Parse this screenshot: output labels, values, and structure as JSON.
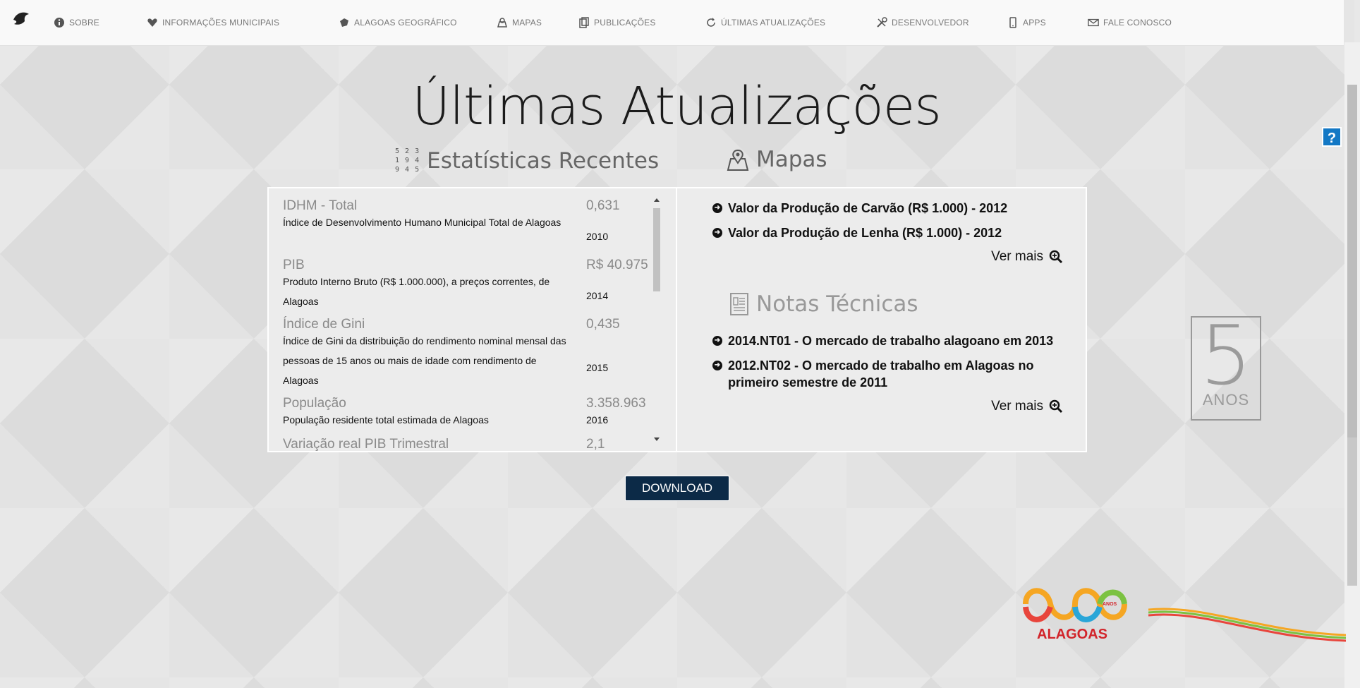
{
  "nav": {
    "items": [
      {
        "label": "SOBRE",
        "icon": "info-icon"
      },
      {
        "label": "INFORMAÇÕES MUNICIPAIS",
        "icon": "map-heart-icon"
      },
      {
        "label": "ALAGOAS GEOGRÁFICO",
        "icon": "state-shape-icon"
      },
      {
        "label": "MAPAS",
        "icon": "map-pin-icon"
      },
      {
        "label": "PUBLICAÇÕES",
        "icon": "documents-icon"
      },
      {
        "label": "ÚLTIMAS ATUALIZAÇÕES",
        "icon": "refresh-icon"
      },
      {
        "label": "DESENVOLVEDOR",
        "icon": "tools-icon"
      },
      {
        "label": "APPS",
        "icon": "mobile-icon"
      },
      {
        "label": "FALE CONOSCO",
        "icon": "mail-icon"
      }
    ]
  },
  "page": {
    "title": "Últimas Atualizações"
  },
  "sections": {
    "stats_title": "Estatísticas Recentes",
    "stats_icon_numbers": [
      "5 2 3",
      "1 9 4",
      "9 4 5"
    ],
    "maps_title": "Mapas",
    "notes_title": "Notas Técnicas"
  },
  "stats": [
    {
      "title": "IDHM - Total",
      "value": "0,631",
      "desc": "Índice de Desenvolvimento Humano Municipal Total de Alagoas",
      "year": "2010"
    },
    {
      "title": "PIB",
      "value": "R$ 40.975",
      "desc": "Produto Interno Bruto (R$ 1.000.000), a preços correntes, de Alagoas",
      "year": "2014"
    },
    {
      "title": "Índice de Gini",
      "value": "0,435",
      "desc": "Índice de Gini da distribuição do rendimento nominal mensal das pessoas de 15 anos ou mais de idade com rendimento de Alagoas",
      "year": "2015"
    },
    {
      "title": "População",
      "value": "3.358.963",
      "desc": "População residente total estimada de Alagoas",
      "year": "2016"
    },
    {
      "title": "Variação real PIB Trimestral",
      "value": "2,1",
      "desc": "",
      "year": ""
    }
  ],
  "maps": [
    {
      "label": "Valor da Produção de Carvão (R$ 1.000) - 2012"
    },
    {
      "label": "Valor da Produção de Lenha (R$ 1.000) - 2012"
    }
  ],
  "notes": [
    {
      "label": "2014.NT01 - O mercado de trabalho alagoano em 2013"
    },
    {
      "label": "2012.NT02 - O mercado de trabalho em Alagoas no primeiro semestre de 2011"
    }
  ],
  "ver_mais": "Ver mais",
  "download": "DOWNLOAD",
  "badge": {
    "number": "5",
    "text": "ANOS"
  },
  "brand": {
    "name": "ALAGOAS",
    "small": "ANOS"
  },
  "help": "?",
  "colors": {
    "accent": "#0c2a47",
    "help": "#1378c5",
    "brand_red": "#d2242a"
  }
}
